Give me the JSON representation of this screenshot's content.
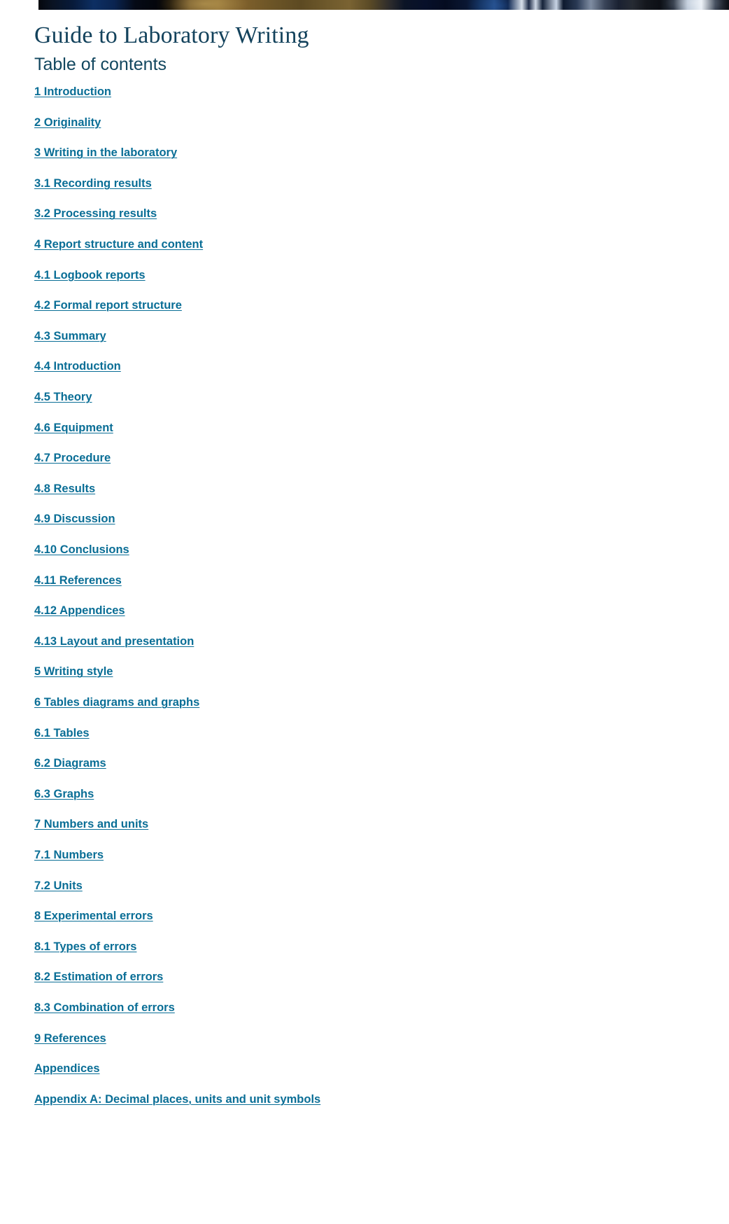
{
  "hero": {
    "image_name": "laboratory-hero-photo",
    "description": "partially visible photographic banner strip"
  },
  "document": {
    "title": "Guide to Laboratory Writing",
    "toc_heading": "Table of contents"
  },
  "theme": {
    "link_color": "#0a6e96",
    "title_color": "#13425c",
    "heading_color": "#12475f",
    "background": "#ffffff"
  },
  "toc": {
    "items": [
      {
        "label": "1 Introduction"
      },
      {
        "label": "2 Originality"
      },
      {
        "label": "3 Writing in the laboratory"
      },
      {
        "label": "3.1 Recording results"
      },
      {
        "label": "3.2 Processing results"
      },
      {
        "label": "4 Report structure and content"
      },
      {
        "label": "4.1 Logbook reports"
      },
      {
        "label": "4.2 Formal report structure"
      },
      {
        "label": "4.3 Summary"
      },
      {
        "label": "4.4 Introduction"
      },
      {
        "label": "4.5 Theory"
      },
      {
        "label": "4.6 Equipment"
      },
      {
        "label": "4.7 Procedure"
      },
      {
        "label": "4.8 Results"
      },
      {
        "label": "4.9 Discussion"
      },
      {
        "label": "4.10 Conclusions"
      },
      {
        "label": "4.11 References"
      },
      {
        "label": "4.12 Appendices"
      },
      {
        "label": "4.13 Layout and presentation"
      },
      {
        "label": "5 Writing style"
      },
      {
        "label": "6 Tables diagrams and graphs"
      },
      {
        "label": "6.1 Tables"
      },
      {
        "label": "6.2 Diagrams"
      },
      {
        "label": "6.3 Graphs"
      },
      {
        "label": "7 Numbers and units"
      },
      {
        "label": "7.1 Numbers"
      },
      {
        "label": "7.2 Units"
      },
      {
        "label": "8 Experimental errors"
      },
      {
        "label": "8.1 Types of errors"
      },
      {
        "label": "8.2 Estimation of errors"
      },
      {
        "label": "8.3 Combination of errors"
      },
      {
        "label": "9 References"
      },
      {
        "label": "Appendices"
      },
      {
        "label": "Appendix A: Decimal places, units and unit symbols"
      }
    ]
  }
}
